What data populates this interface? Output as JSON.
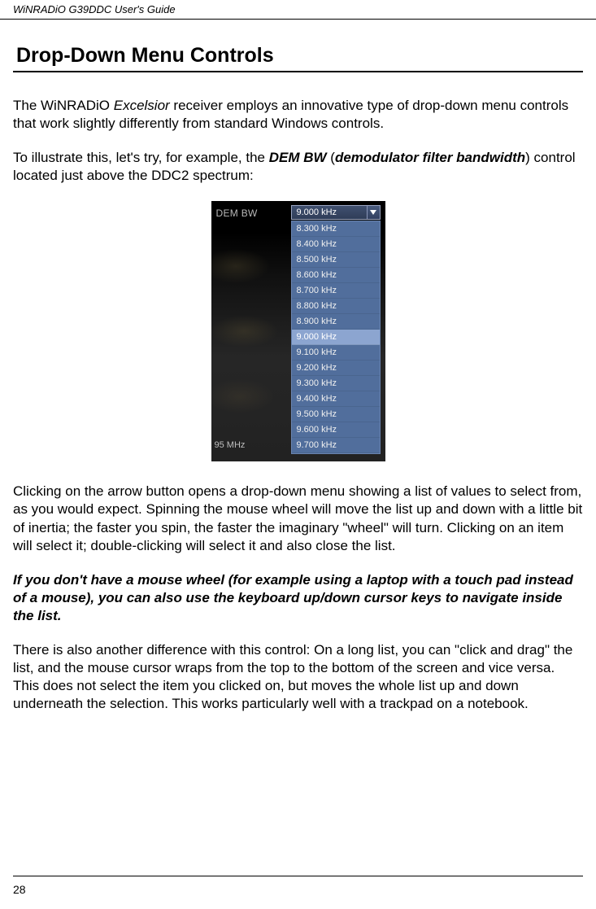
{
  "header": {
    "doc_title": "WiNRADiO G39DDC User's Guide"
  },
  "section": {
    "title": "Drop-Down Menu Controls"
  },
  "para1": {
    "pre": "The WiNRADiO ",
    "em": "Excelsior",
    "post": " receiver employs an innovative type of drop-down menu controls that work slightly differently from standard Windows controls."
  },
  "para2": {
    "pre": "To illustrate this, let's try, for example, the ",
    "b1": "DEM BW",
    "mid": " (",
    "bi": "demodulator filter bandwidth",
    "post": ") control located just above the DDC2 spectrum:"
  },
  "dropdown": {
    "label": "DEM BW",
    "selected": "9.000 kHz",
    "options": [
      "8.300 kHz",
      "8.400 kHz",
      "8.500 kHz",
      "8.600 kHz",
      "8.700 kHz",
      "8.800 kHz",
      "8.900 kHz",
      "9.000 kHz",
      "9.100 kHz",
      "9.200 kHz",
      "9.300 kHz",
      "9.400 kHz",
      "9.500 kHz",
      "9.600 kHz",
      "9.700 kHz"
    ],
    "selected_index": 7,
    "caption": "95 MHz"
  },
  "para3": "Clicking on the arrow button opens a drop-down menu showing a list of values to select from, as you would expect. Spinning the mouse wheel will move the list up and down with a little bit of inertia; the faster you spin, the faster the imaginary \"wheel\" will turn. Clicking on an item will select it; double-clicking will select it and also close the list.",
  "para4": "If you don't have a mouse wheel (for example using a laptop with a touch pad instead of a mouse), you can also use the keyboard up/down cursor keys to navigate inside the list.",
  "para5": "There is also another difference with this control: On a long list, you can \"click and drag\" the list, and the mouse cursor wraps from the top to the bottom of the screen and vice versa. This does not select the item you clicked on, but moves the whole list up and down underneath the selection. This works particularly well with a trackpad on a notebook.",
  "page_number": "28"
}
